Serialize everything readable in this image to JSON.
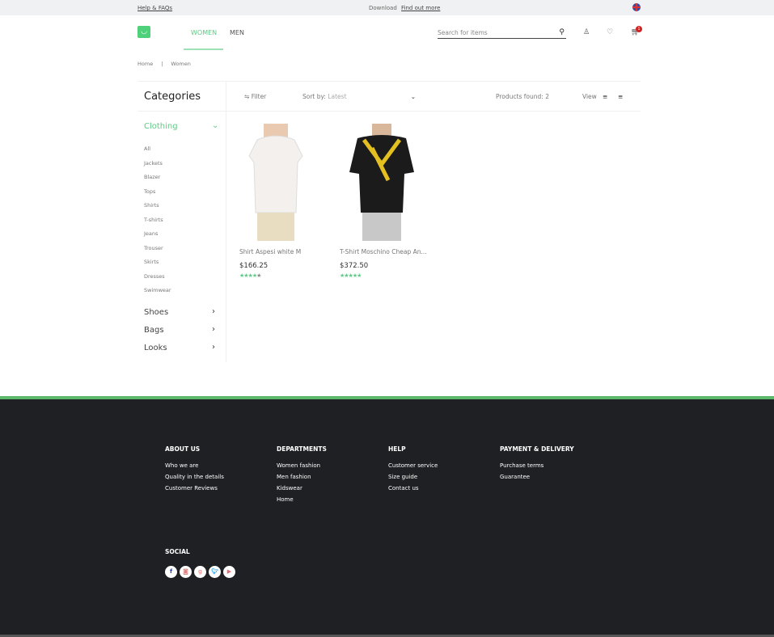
{
  "topbar": {
    "help": "Help & FAQs",
    "download": "Download",
    "find_out": "Find out more",
    "flag_icon": "uk-flag-icon"
  },
  "header": {
    "logo_icon": "shopping-bag-icon",
    "nav": [
      "WOMEN",
      "MEN"
    ],
    "search_placeholder": "Search for items",
    "cart_count": "1"
  },
  "breadcrumb": [
    "Home",
    "|",
    "Women"
  ],
  "filterbar": {
    "categories_title": "Categories",
    "filter": "Filter",
    "sort_label": "Sort by:",
    "sort_value": "Latest",
    "products_found_label": "Products found:",
    "products_found": "2",
    "view": "View"
  },
  "sidebar": {
    "clothing": "Clothing",
    "items": [
      "All",
      "Jackets",
      "Blazer",
      "Tops",
      "Shirts",
      "T-shirts",
      "Jeans",
      "Trouser",
      "Skirts",
      "Dresses",
      "Swimwear"
    ],
    "other": [
      "Shoes",
      "Bags",
      "Looks"
    ]
  },
  "products": [
    {
      "name": "Shirt Aspesi white M",
      "price": "$166.25",
      "rating": 4
    },
    {
      "name": "T-Shirt Moschino Cheap An...",
      "price": "$372.50",
      "rating": 4.5
    }
  ],
  "footer": {
    "columns": [
      {
        "title": "ABOUT US",
        "links": [
          "Who we are",
          "Quality in the details",
          "Customer Reviews"
        ]
      },
      {
        "title": "DEPARTMENTS",
        "links": [
          "Women fashion",
          "Men fashion",
          "Kidswear",
          "Home"
        ]
      },
      {
        "title": "HELP",
        "links": [
          "Customer service",
          "Size guide",
          "Contact us"
        ]
      },
      {
        "title": "PAYMENT & DELIVERY",
        "links": [
          "Purchase terms",
          "Guarantee"
        ]
      }
    ],
    "social_title": "SOCIAL",
    "social": [
      "facebook",
      "instagram",
      "google-plus",
      "twitter",
      "youtube"
    ]
  },
  "colors": {
    "accent": "#5ecb85",
    "footer_bg": "#1f2024",
    "badge": "#d32020"
  }
}
